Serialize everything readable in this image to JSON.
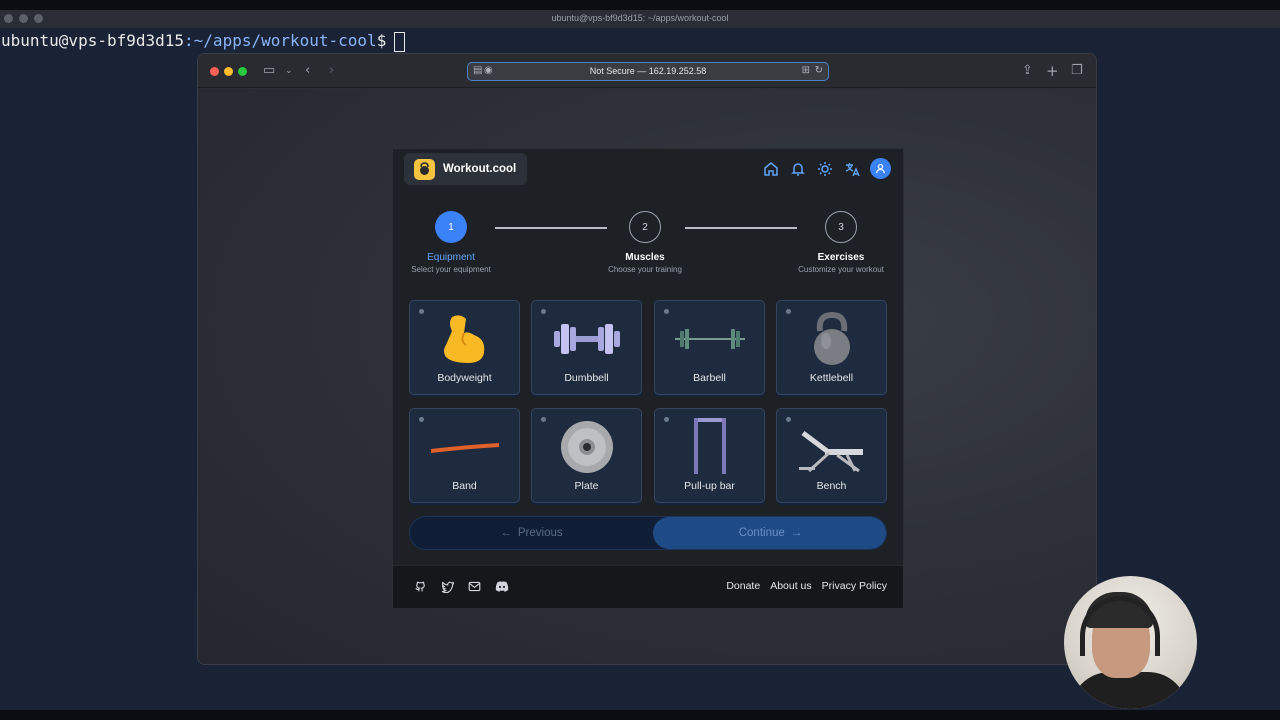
{
  "terminal": {
    "title": "ubuntu@vps-bf9d3d15: ~/apps/workout-cool",
    "prompt_user": "ubuntu@vps-bf9d3d15",
    "prompt_path": ":~/apps/workout-cool",
    "prompt_symbol": "$"
  },
  "browser": {
    "address": "Not Secure — 162.19.252.58"
  },
  "app": {
    "name": "Workout.cool",
    "header_icons": [
      "home-icon",
      "bell-icon",
      "sun-icon",
      "translate-icon",
      "user-icon"
    ],
    "steps": [
      {
        "number": "1",
        "label": "Equipment",
        "sub": "Select your equipment",
        "state": "active"
      },
      {
        "number": "2",
        "label": "Muscles",
        "sub": "Choose your training",
        "state": "idle"
      },
      {
        "number": "3",
        "label": "Exercises",
        "sub": "Customize your workout",
        "state": "idle"
      }
    ],
    "equipment": [
      {
        "label": "Bodyweight",
        "icon": "flexed-biceps-icon"
      },
      {
        "label": "Dumbbell",
        "icon": "dumbbell-icon"
      },
      {
        "label": "Barbell",
        "icon": "barbell-icon"
      },
      {
        "label": "Kettlebell",
        "icon": "kettlebell-icon"
      },
      {
        "label": "Band",
        "icon": "band-icon"
      },
      {
        "label": "Plate",
        "icon": "plate-icon"
      },
      {
        "label": "Pull-up bar",
        "icon": "pullup-bar-icon"
      },
      {
        "label": "Bench",
        "icon": "bench-icon"
      }
    ],
    "nav": {
      "previous": "Previous",
      "continue": "Continue"
    },
    "footer": {
      "icons": [
        "github-icon",
        "twitter-icon",
        "mail-icon",
        "discord-icon"
      ],
      "links": [
        "Donate",
        "About us",
        "Privacy Policy"
      ]
    },
    "colors": {
      "accent": "#3b82f6",
      "tile_bg": "#1e2a3d",
      "card_bg": "#1d2025"
    }
  }
}
